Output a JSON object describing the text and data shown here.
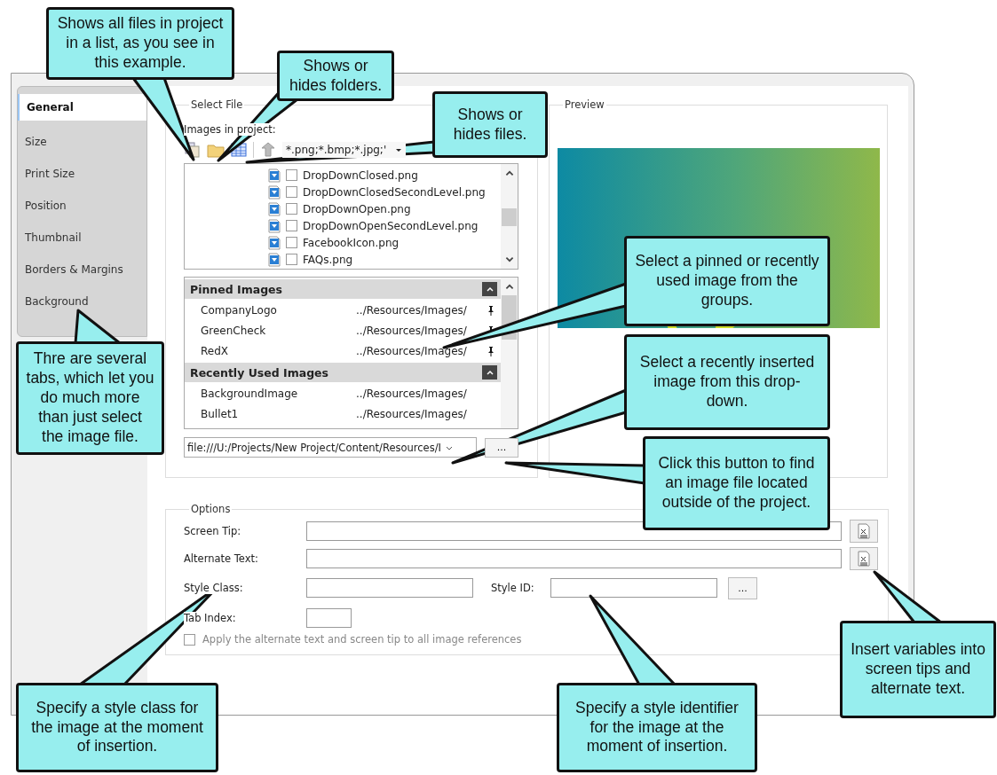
{
  "tabs": [
    {
      "label": "General",
      "selected": true
    },
    {
      "label": "Size",
      "selected": false
    },
    {
      "label": "Print Size",
      "selected": false
    },
    {
      "label": "Position",
      "selected": false
    },
    {
      "label": "Thumbnail",
      "selected": false
    },
    {
      "label": "Borders & Margins",
      "selected": false
    },
    {
      "label": "Background",
      "selected": false
    }
  ],
  "select_file": {
    "title": "Select File",
    "images_label": "Images in project:",
    "filter": "*.png;*.bmp;*.jpg;'",
    "files": [
      {
        "name": "DropDownClosed.png",
        "checked": false
      },
      {
        "name": "DropDownClosedSecondLevel.png",
        "checked": false
      },
      {
        "name": "DropDownOpen.png",
        "checked": false
      },
      {
        "name": "DropDownOpenSecondLevel.png",
        "checked": false
      },
      {
        "name": "FacebookIcon.png",
        "checked": false
      },
      {
        "name": "FAQs.png",
        "checked": false
      }
    ],
    "groups": [
      {
        "title": "Pinned Images",
        "expanded": true,
        "items": [
          {
            "name": "CompanyLogo",
            "path": "../Resources/Images/",
            "pinned": true
          },
          {
            "name": "GreenCheck",
            "path": "../Resources/Images/",
            "pinned": true
          },
          {
            "name": "RedX",
            "path": "../Resources/Images/",
            "pinned": true
          }
        ]
      },
      {
        "title": "Recently Used Images",
        "expanded": true,
        "items": [
          {
            "name": "BackgroundImage",
            "path": "../Resources/Images/",
            "pinned": false
          },
          {
            "name": "Bullet1",
            "path": "../Resources/Images/",
            "pinned": false
          }
        ]
      }
    ],
    "url": "file:///U:/Projects/New Project/Content/Resources/I",
    "browse_button": "..."
  },
  "preview": {
    "title": "Preview"
  },
  "options": {
    "title": "Options",
    "rows": [
      {
        "kind": "variable",
        "label": "Screen Tip:"
      },
      {
        "kind": "variable",
        "label": "Alternate Text:"
      },
      {
        "kind": "pair",
        "label": "Style Class:",
        "second_label": "Style ID:",
        "button": "..."
      },
      {
        "kind": "short",
        "label": "Tab Index:"
      }
    ],
    "apply_all": {
      "label": "Apply the alternate text and screen tip to all image references",
      "checked": false,
      "disabled": true
    }
  },
  "callouts": [
    "Shows all files in project in a list, as you see in this example.",
    "Shows or hides folders.",
    "Shows or hides files.",
    "Select a pinned or recently used image from the groups.",
    "Select a recently inserted image from this drop-down.",
    "Click this button to find an image file located outside of the project.",
    "Thre are several tabs, which let you do much more than just select the image file.",
    "Specify a style class for the image at the moment of insertion.",
    "Specify a style identifier for the image at the moment of insertion.",
    "Insert variables into screen tips and alternate text."
  ]
}
